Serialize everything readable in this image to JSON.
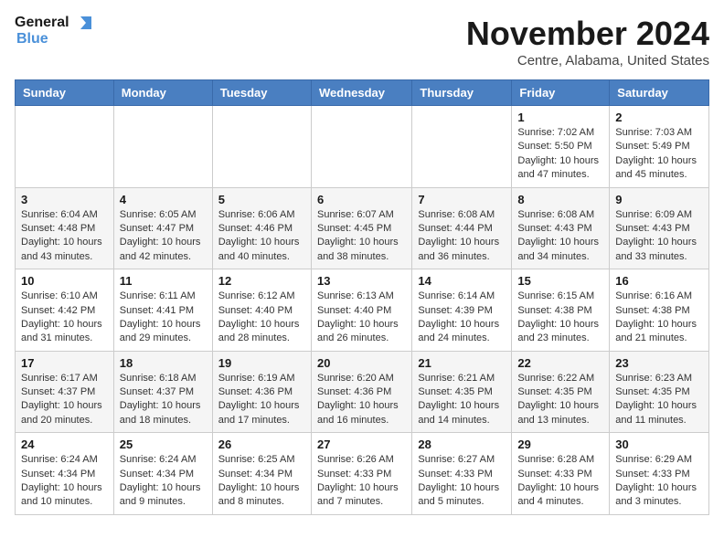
{
  "logo": {
    "line1": "General",
    "line2": "Blue"
  },
  "title": "November 2024",
  "subtitle": "Centre, Alabama, United States",
  "days_of_week": [
    "Sunday",
    "Monday",
    "Tuesday",
    "Wednesday",
    "Thursday",
    "Friday",
    "Saturday"
  ],
  "weeks": [
    [
      {
        "day": "",
        "info": ""
      },
      {
        "day": "",
        "info": ""
      },
      {
        "day": "",
        "info": ""
      },
      {
        "day": "",
        "info": ""
      },
      {
        "day": "",
        "info": ""
      },
      {
        "day": "1",
        "info": "Sunrise: 7:02 AM\nSunset: 5:50 PM\nDaylight: 10 hours and 47 minutes."
      },
      {
        "day": "2",
        "info": "Sunrise: 7:03 AM\nSunset: 5:49 PM\nDaylight: 10 hours and 45 minutes."
      }
    ],
    [
      {
        "day": "3",
        "info": "Sunrise: 6:04 AM\nSunset: 4:48 PM\nDaylight: 10 hours and 43 minutes."
      },
      {
        "day": "4",
        "info": "Sunrise: 6:05 AM\nSunset: 4:47 PM\nDaylight: 10 hours and 42 minutes."
      },
      {
        "day": "5",
        "info": "Sunrise: 6:06 AM\nSunset: 4:46 PM\nDaylight: 10 hours and 40 minutes."
      },
      {
        "day": "6",
        "info": "Sunrise: 6:07 AM\nSunset: 4:45 PM\nDaylight: 10 hours and 38 minutes."
      },
      {
        "day": "7",
        "info": "Sunrise: 6:08 AM\nSunset: 4:44 PM\nDaylight: 10 hours and 36 minutes."
      },
      {
        "day": "8",
        "info": "Sunrise: 6:08 AM\nSunset: 4:43 PM\nDaylight: 10 hours and 34 minutes."
      },
      {
        "day": "9",
        "info": "Sunrise: 6:09 AM\nSunset: 4:43 PM\nDaylight: 10 hours and 33 minutes."
      }
    ],
    [
      {
        "day": "10",
        "info": "Sunrise: 6:10 AM\nSunset: 4:42 PM\nDaylight: 10 hours and 31 minutes."
      },
      {
        "day": "11",
        "info": "Sunrise: 6:11 AM\nSunset: 4:41 PM\nDaylight: 10 hours and 29 minutes."
      },
      {
        "day": "12",
        "info": "Sunrise: 6:12 AM\nSunset: 4:40 PM\nDaylight: 10 hours and 28 minutes."
      },
      {
        "day": "13",
        "info": "Sunrise: 6:13 AM\nSunset: 4:40 PM\nDaylight: 10 hours and 26 minutes."
      },
      {
        "day": "14",
        "info": "Sunrise: 6:14 AM\nSunset: 4:39 PM\nDaylight: 10 hours and 24 minutes."
      },
      {
        "day": "15",
        "info": "Sunrise: 6:15 AM\nSunset: 4:38 PM\nDaylight: 10 hours and 23 minutes."
      },
      {
        "day": "16",
        "info": "Sunrise: 6:16 AM\nSunset: 4:38 PM\nDaylight: 10 hours and 21 minutes."
      }
    ],
    [
      {
        "day": "17",
        "info": "Sunrise: 6:17 AM\nSunset: 4:37 PM\nDaylight: 10 hours and 20 minutes."
      },
      {
        "day": "18",
        "info": "Sunrise: 6:18 AM\nSunset: 4:37 PM\nDaylight: 10 hours and 18 minutes."
      },
      {
        "day": "19",
        "info": "Sunrise: 6:19 AM\nSunset: 4:36 PM\nDaylight: 10 hours and 17 minutes."
      },
      {
        "day": "20",
        "info": "Sunrise: 6:20 AM\nSunset: 4:36 PM\nDaylight: 10 hours and 16 minutes."
      },
      {
        "day": "21",
        "info": "Sunrise: 6:21 AM\nSunset: 4:35 PM\nDaylight: 10 hours and 14 minutes."
      },
      {
        "day": "22",
        "info": "Sunrise: 6:22 AM\nSunset: 4:35 PM\nDaylight: 10 hours and 13 minutes."
      },
      {
        "day": "23",
        "info": "Sunrise: 6:23 AM\nSunset: 4:35 PM\nDaylight: 10 hours and 11 minutes."
      }
    ],
    [
      {
        "day": "24",
        "info": "Sunrise: 6:24 AM\nSunset: 4:34 PM\nDaylight: 10 hours and 10 minutes."
      },
      {
        "day": "25",
        "info": "Sunrise: 6:24 AM\nSunset: 4:34 PM\nDaylight: 10 hours and 9 minutes."
      },
      {
        "day": "26",
        "info": "Sunrise: 6:25 AM\nSunset: 4:34 PM\nDaylight: 10 hours and 8 minutes."
      },
      {
        "day": "27",
        "info": "Sunrise: 6:26 AM\nSunset: 4:33 PM\nDaylight: 10 hours and 7 minutes."
      },
      {
        "day": "28",
        "info": "Sunrise: 6:27 AM\nSunset: 4:33 PM\nDaylight: 10 hours and 5 minutes."
      },
      {
        "day": "29",
        "info": "Sunrise: 6:28 AM\nSunset: 4:33 PM\nDaylight: 10 hours and 4 minutes."
      },
      {
        "day": "30",
        "info": "Sunrise: 6:29 AM\nSunset: 4:33 PM\nDaylight: 10 hours and 3 minutes."
      }
    ]
  ]
}
